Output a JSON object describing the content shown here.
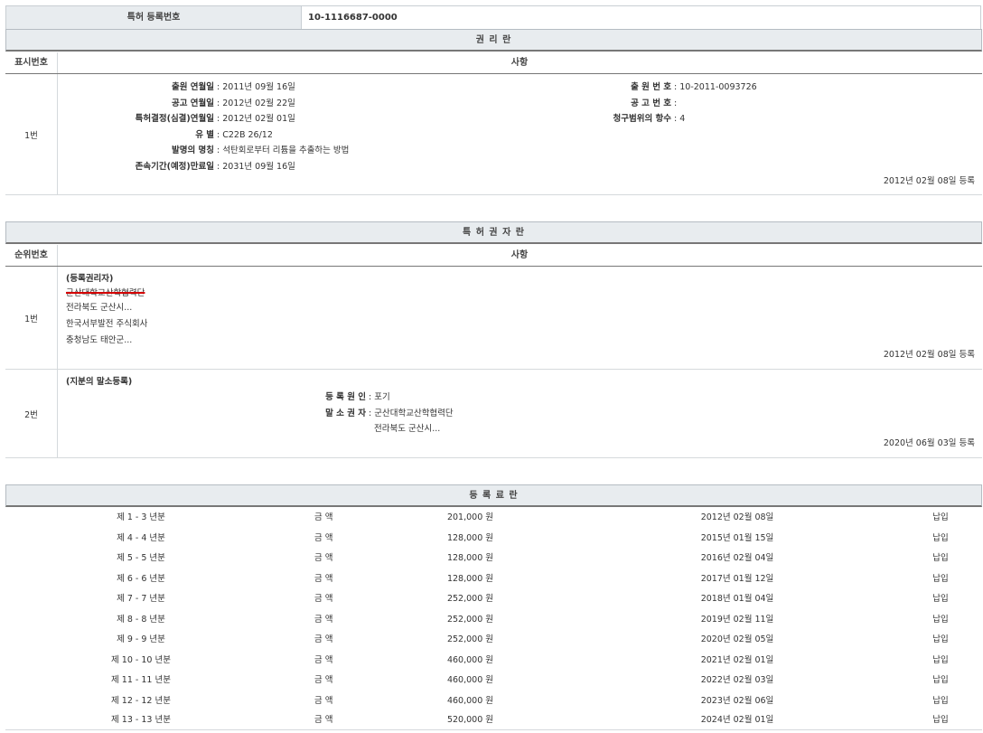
{
  "registration": {
    "label": "특허 등록번호",
    "value": "10-1116687-0000"
  },
  "rights_section": {
    "title": "권 리 란",
    "col_num": "표시번호",
    "col_content": "사항",
    "rows": [
      {
        "num": "1번",
        "left_fields": [
          {
            "key": "출원 연월일",
            "value": "2011년 09월 16일"
          },
          {
            "key": "공고 연월일",
            "value": "2012년 02월 22일"
          },
          {
            "key": "특허결정(심결)연월일",
            "value": "2012년 02월 01일"
          },
          {
            "key": "유 별",
            "value": "C22B 26/12"
          },
          {
            "key": "발명의 명칭",
            "value": "석탄회로부터 리튬을 추출하는 방법"
          },
          {
            "key": "존속기간(예정)만료일",
            "value": "2031년 09월 16일"
          }
        ],
        "right_fields": [
          {
            "key": "출 원 번 호",
            "value": "10-2011-0093726"
          },
          {
            "key": "공 고 번 호",
            "value": ""
          },
          {
            "key": "청구범위의 항수",
            "value": "4"
          }
        ],
        "reg_date": "2012년 02월 08일 등록"
      }
    ]
  },
  "holder_section": {
    "title": "특 허 권 자 란",
    "col_num": "순위번호",
    "col_content": "사항",
    "rows": [
      {
        "num": "1번",
        "heading": "(등록권리자)",
        "struck": "군산대학교산학협력단",
        "lines": [
          "전라북도 군산시...",
          "한국서부발전 주식회사",
          "충청남도 태안군..."
        ],
        "reg_date": "2012년 02월 08일 등록"
      },
      {
        "num": "2번",
        "heading": "(지분의 말소등록)",
        "cause_key": "등 록 원 인",
        "cause_value": "포기",
        "cancel_key": "말 소 권 자",
        "cancel_value": "군산대학교산학협력단",
        "cancel_addr": "전라북도 군산시...",
        "reg_date": "2020년 06월 03일 등록"
      }
    ]
  },
  "fee_section": {
    "title": "등 록 료 란",
    "rows": [
      {
        "period": "제 1 - 3 년분",
        "label": "금 액",
        "amount": "201,000 원",
        "date": "2012년 02월 08일",
        "status": "납입"
      },
      {
        "period": "제 4 - 4 년분",
        "label": "금 액",
        "amount": "128,000 원",
        "date": "2015년 01월 15일",
        "status": "납입"
      },
      {
        "period": "제 5 - 5 년분",
        "label": "금 액",
        "amount": "128,000 원",
        "date": "2016년 02월 04일",
        "status": "납입"
      },
      {
        "period": "제 6 - 6 년분",
        "label": "금 액",
        "amount": "128,000 원",
        "date": "2017년 01월 12일",
        "status": "납입"
      },
      {
        "period": "제 7 - 7 년분",
        "label": "금 액",
        "amount": "252,000 원",
        "date": "2018년 01월 04일",
        "status": "납입"
      },
      {
        "period": "제 8 - 8 년분",
        "label": "금 액",
        "amount": "252,000 원",
        "date": "2019년 02월 11일",
        "status": "납입"
      },
      {
        "period": "제 9 - 9 년분",
        "label": "금 액",
        "amount": "252,000 원",
        "date": "2020년 02월 05일",
        "status": "납입"
      },
      {
        "period": "제 10 - 10 년분",
        "label": "금 액",
        "amount": "460,000 원",
        "date": "2021년 02월 01일",
        "status": "납입"
      },
      {
        "period": "제 11 - 11 년분",
        "label": "금 액",
        "amount": "460,000 원",
        "date": "2022년 02월 03일",
        "status": "납입"
      },
      {
        "period": "제 12 - 12 년분",
        "label": "금 액",
        "amount": "460,000 원",
        "date": "2023년 02월 06일",
        "status": "납입"
      },
      {
        "period": "제 13 - 13 년분",
        "label": "금 액",
        "amount": "520,000 원",
        "date": "2024년 02월 01일",
        "status": "납입"
      }
    ]
  }
}
